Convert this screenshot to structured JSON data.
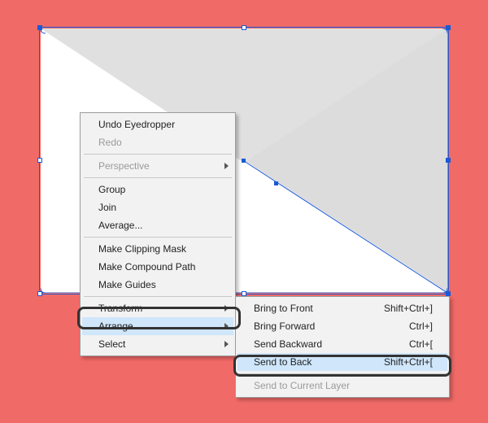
{
  "menu": {
    "undo": "Undo Eyedropper",
    "redo": "Redo",
    "perspective": "Perspective",
    "group": "Group",
    "join": "Join",
    "average": "Average...",
    "clip": "Make Clipping Mask",
    "compound": "Make Compound Path",
    "guides": "Make Guides",
    "transform": "Transform",
    "arrange": "Arrange",
    "select": "Select"
  },
  "submenu": {
    "bringFront": {
      "label": "Bring to Front",
      "shortcut": "Shift+Ctrl+]"
    },
    "bringForward": {
      "label": "Bring Forward",
      "shortcut": "Ctrl+]"
    },
    "sendBackward": {
      "label": "Send Backward",
      "shortcut": "Ctrl+["
    },
    "sendBack": {
      "label": "Send to Back",
      "shortcut": "Shift+Ctrl+["
    },
    "sendLayer": {
      "label": "Send to Current Layer"
    }
  },
  "colors": {
    "bg": "#f06a67",
    "selection": "#1a5ad6",
    "hover": "#cfe6fb"
  }
}
